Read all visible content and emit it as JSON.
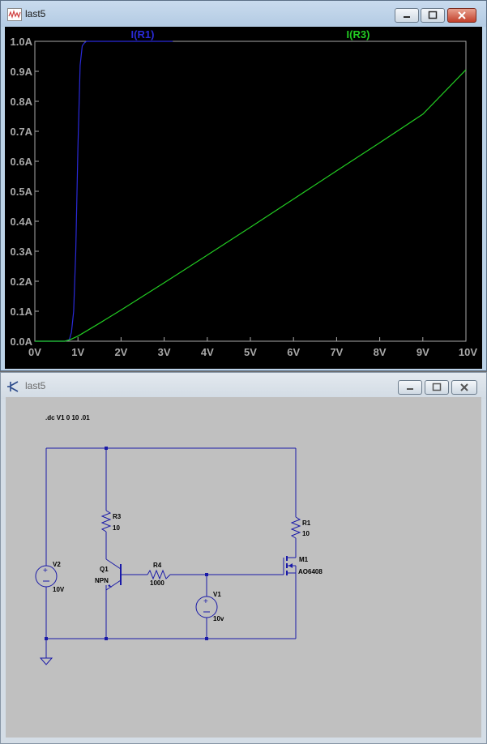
{
  "plot_window": {
    "title": "last5",
    "controls": {
      "minimize": "minimize",
      "maximize": "maximize",
      "close": "close"
    }
  },
  "schematic_window": {
    "title": "last5",
    "directive": ".dc V1 0 10 .01",
    "components": {
      "R3": {
        "name": "R3",
        "value": "10"
      },
      "R1": {
        "name": "R1",
        "value": "10"
      },
      "R4": {
        "name": "R4",
        "value": "1000"
      },
      "Q1": {
        "name": "Q1",
        "value": "NPN"
      },
      "M1": {
        "name": "M1",
        "value": "AO6408"
      },
      "V2": {
        "name": "V2",
        "value": "10V"
      },
      "V1": {
        "name": "V1",
        "value": "10v"
      }
    }
  },
  "colors": {
    "plot_background": "#000000",
    "axis_text": "#a8a8a8",
    "trace_r1": "#2a2ad8",
    "trace_r3": "#22cc22",
    "wire": "#1a1aa8",
    "schematic_background": "#c0c0c0"
  },
  "chart_data": {
    "type": "line",
    "x_ticks": [
      "0V",
      "1V",
      "2V",
      "3V",
      "4V",
      "5V",
      "6V",
      "7V",
      "8V",
      "9V",
      "10V"
    ],
    "y_ticks": [
      "0.0A",
      "0.1A",
      "0.2A",
      "0.3A",
      "0.4A",
      "0.5A",
      "0.6A",
      "0.7A",
      "0.8A",
      "0.9A",
      "1.0A"
    ],
    "xlim": [
      0,
      10
    ],
    "ylim": [
      0,
      1.0
    ],
    "grid": false,
    "series": [
      {
        "name": "I(R1)",
        "x": [
          0,
          0.7,
          0.8,
          0.85,
          0.9,
          0.95,
          1.0,
          1.05,
          1.1,
          1.15,
          1.2,
          1.5,
          3.2
        ],
        "y": [
          0,
          0,
          0.005,
          0.03,
          0.1,
          0.3,
          0.65,
          0.92,
          0.985,
          0.995,
          1.0,
          1.0,
          1.0
        ]
      },
      {
        "name": "I(R3)",
        "x": [
          0,
          0.7,
          0.8,
          1.0,
          1.5,
          2,
          3,
          4,
          5,
          6,
          7,
          8,
          9,
          10
        ],
        "y": [
          0,
          0,
          0.004,
          0.017,
          0.06,
          0.104,
          0.195,
          0.287,
          0.38,
          0.474,
          0.568,
          0.662,
          0.757,
          0.905
        ]
      }
    ]
  }
}
